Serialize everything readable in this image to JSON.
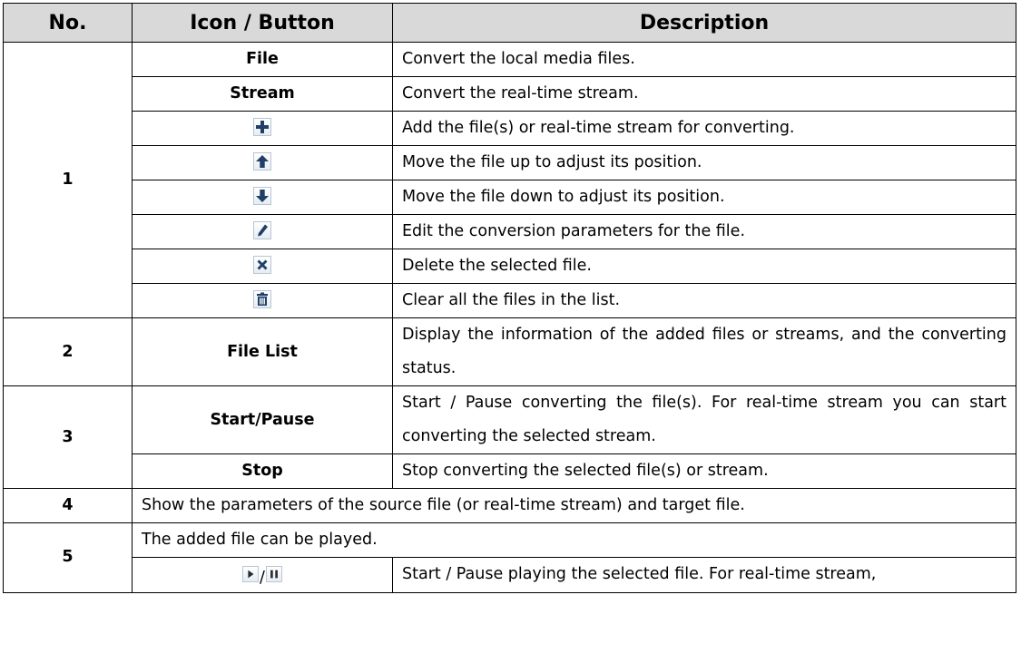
{
  "headers": {
    "no": "No.",
    "icon": "Icon / Button",
    "desc": "Description"
  },
  "rows": {
    "r1": {
      "no": "1",
      "file": "File",
      "file_desc": "Convert the local media files.",
      "stream": "Stream",
      "stream_desc": "Convert the real-time stream.",
      "add_desc": "Add the file(s) or real-time stream for converting.",
      "up_desc": "Move the file up to adjust its position.",
      "down_desc": "Move the file down to adjust its position.",
      "edit_desc": "Edit the conversion parameters for the file.",
      "delete_desc": "Delete the selected file.",
      "clear_desc": "Clear all the files in the list."
    },
    "r2": {
      "no": "2",
      "btn": "File List",
      "desc": "Display the information of the added files or streams, and the converting status."
    },
    "r3": {
      "no": "3",
      "start": "Start/Pause",
      "start_desc": "Start / Pause converting the file(s). For real-time stream you can start converting the selected stream.",
      "stop": "Stop",
      "stop_desc": "Stop converting the selected file(s) or stream."
    },
    "r4": {
      "no": "4",
      "desc": "Show the parameters of the source file (or real-time stream) and target file."
    },
    "r5": {
      "no": "5",
      "desc": "The added file can be played.",
      "sep": "/",
      "play_desc": "Start / Pause playing the selected file. For real-time stream,"
    }
  },
  "icons": [
    "plus-icon",
    "arrow-up-icon",
    "arrow-down-icon",
    "pencil-icon",
    "close-icon",
    "trash-icon",
    "play-icon",
    "pause-icon"
  ],
  "colors": {
    "header_bg": "#d9d9d9",
    "icon_blue": "#1f3f66"
  }
}
